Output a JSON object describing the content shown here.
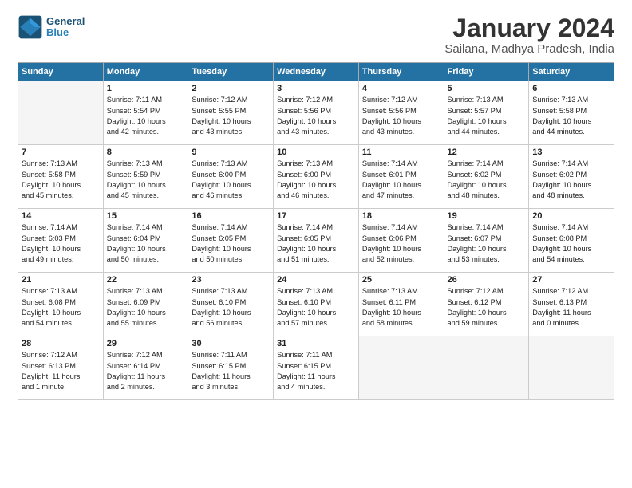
{
  "header": {
    "logo_line1": "General",
    "logo_line2": "Blue",
    "title": "January 2024",
    "subtitle": "Sailana, Madhya Pradesh, India"
  },
  "days_of_week": [
    "Sunday",
    "Monday",
    "Tuesday",
    "Wednesday",
    "Thursday",
    "Friday",
    "Saturday"
  ],
  "weeks": [
    [
      {
        "num": "",
        "info": ""
      },
      {
        "num": "1",
        "info": "Sunrise: 7:11 AM\nSunset: 5:54 PM\nDaylight: 10 hours\nand 42 minutes."
      },
      {
        "num": "2",
        "info": "Sunrise: 7:12 AM\nSunset: 5:55 PM\nDaylight: 10 hours\nand 43 minutes."
      },
      {
        "num": "3",
        "info": "Sunrise: 7:12 AM\nSunset: 5:56 PM\nDaylight: 10 hours\nand 43 minutes."
      },
      {
        "num": "4",
        "info": "Sunrise: 7:12 AM\nSunset: 5:56 PM\nDaylight: 10 hours\nand 43 minutes."
      },
      {
        "num": "5",
        "info": "Sunrise: 7:13 AM\nSunset: 5:57 PM\nDaylight: 10 hours\nand 44 minutes."
      },
      {
        "num": "6",
        "info": "Sunrise: 7:13 AM\nSunset: 5:58 PM\nDaylight: 10 hours\nand 44 minutes."
      }
    ],
    [
      {
        "num": "7",
        "info": "Sunrise: 7:13 AM\nSunset: 5:58 PM\nDaylight: 10 hours\nand 45 minutes."
      },
      {
        "num": "8",
        "info": "Sunrise: 7:13 AM\nSunset: 5:59 PM\nDaylight: 10 hours\nand 45 minutes."
      },
      {
        "num": "9",
        "info": "Sunrise: 7:13 AM\nSunset: 6:00 PM\nDaylight: 10 hours\nand 46 minutes."
      },
      {
        "num": "10",
        "info": "Sunrise: 7:13 AM\nSunset: 6:00 PM\nDaylight: 10 hours\nand 46 minutes."
      },
      {
        "num": "11",
        "info": "Sunrise: 7:14 AM\nSunset: 6:01 PM\nDaylight: 10 hours\nand 47 minutes."
      },
      {
        "num": "12",
        "info": "Sunrise: 7:14 AM\nSunset: 6:02 PM\nDaylight: 10 hours\nand 48 minutes."
      },
      {
        "num": "13",
        "info": "Sunrise: 7:14 AM\nSunset: 6:02 PM\nDaylight: 10 hours\nand 48 minutes."
      }
    ],
    [
      {
        "num": "14",
        "info": "Sunrise: 7:14 AM\nSunset: 6:03 PM\nDaylight: 10 hours\nand 49 minutes."
      },
      {
        "num": "15",
        "info": "Sunrise: 7:14 AM\nSunset: 6:04 PM\nDaylight: 10 hours\nand 50 minutes."
      },
      {
        "num": "16",
        "info": "Sunrise: 7:14 AM\nSunset: 6:05 PM\nDaylight: 10 hours\nand 50 minutes."
      },
      {
        "num": "17",
        "info": "Sunrise: 7:14 AM\nSunset: 6:05 PM\nDaylight: 10 hours\nand 51 minutes."
      },
      {
        "num": "18",
        "info": "Sunrise: 7:14 AM\nSunset: 6:06 PM\nDaylight: 10 hours\nand 52 minutes."
      },
      {
        "num": "19",
        "info": "Sunrise: 7:14 AM\nSunset: 6:07 PM\nDaylight: 10 hours\nand 53 minutes."
      },
      {
        "num": "20",
        "info": "Sunrise: 7:14 AM\nSunset: 6:08 PM\nDaylight: 10 hours\nand 54 minutes."
      }
    ],
    [
      {
        "num": "21",
        "info": "Sunrise: 7:13 AM\nSunset: 6:08 PM\nDaylight: 10 hours\nand 54 minutes."
      },
      {
        "num": "22",
        "info": "Sunrise: 7:13 AM\nSunset: 6:09 PM\nDaylight: 10 hours\nand 55 minutes."
      },
      {
        "num": "23",
        "info": "Sunrise: 7:13 AM\nSunset: 6:10 PM\nDaylight: 10 hours\nand 56 minutes."
      },
      {
        "num": "24",
        "info": "Sunrise: 7:13 AM\nSunset: 6:10 PM\nDaylight: 10 hours\nand 57 minutes."
      },
      {
        "num": "25",
        "info": "Sunrise: 7:13 AM\nSunset: 6:11 PM\nDaylight: 10 hours\nand 58 minutes."
      },
      {
        "num": "26",
        "info": "Sunrise: 7:12 AM\nSunset: 6:12 PM\nDaylight: 10 hours\nand 59 minutes."
      },
      {
        "num": "27",
        "info": "Sunrise: 7:12 AM\nSunset: 6:13 PM\nDaylight: 11 hours\nand 0 minutes."
      }
    ],
    [
      {
        "num": "28",
        "info": "Sunrise: 7:12 AM\nSunset: 6:13 PM\nDaylight: 11 hours\nand 1 minute."
      },
      {
        "num": "29",
        "info": "Sunrise: 7:12 AM\nSunset: 6:14 PM\nDaylight: 11 hours\nand 2 minutes."
      },
      {
        "num": "30",
        "info": "Sunrise: 7:11 AM\nSunset: 6:15 PM\nDaylight: 11 hours\nand 3 minutes."
      },
      {
        "num": "31",
        "info": "Sunrise: 7:11 AM\nSunset: 6:15 PM\nDaylight: 11 hours\nand 4 minutes."
      },
      {
        "num": "",
        "info": ""
      },
      {
        "num": "",
        "info": ""
      },
      {
        "num": "",
        "info": ""
      }
    ]
  ]
}
